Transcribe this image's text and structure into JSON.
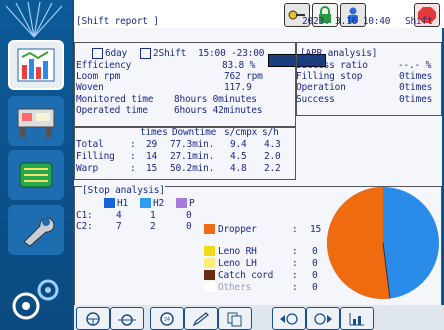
{
  "header": {
    "title": "Shift report",
    "datetime": "2023. 3.16 10:40",
    "mode": "Shift"
  },
  "period": {
    "day_label": "6day",
    "shift_label": "2Shift",
    "shift_time": "15:00 -23:00"
  },
  "stats": [
    {
      "label": "Efficiency",
      "value": "83.8 %"
    },
    {
      "label": "Loom rpm",
      "value": "762 rpm"
    },
    {
      "label": "Woven",
      "value": "117.9"
    },
    {
      "label": "Monitored time",
      "value": "8hours 0minutes"
    },
    {
      "label": "Operated time",
      "value": "6hours 42minutes"
    }
  ],
  "stop_table": {
    "headers": [
      "times",
      "Downtime",
      "s/cmpx",
      "s/h"
    ],
    "rows": [
      {
        "name": "Total",
        "times": "29",
        "downtime": "77.3min.",
        "scmpx": "9.4",
        "sh": "4.3"
      },
      {
        "name": "Filling",
        "times": "14",
        "downtime": "27.1min.",
        "scmpx": "4.5",
        "sh": "2.0"
      },
      {
        "name": "Warp",
        "times": "15",
        "downtime": "50.2min.",
        "scmpx": "4.8",
        "sh": "2.2"
      }
    ]
  },
  "apr": {
    "title": "APR analysis",
    "rows": [
      {
        "label": "Success ratio",
        "value": "--.- %"
      },
      {
        "label": "Filling stop",
        "value": "0times"
      },
      {
        "label": "Operation",
        "value": "0times"
      },
      {
        "label": "Success",
        "value": "0times"
      }
    ]
  },
  "stop_analysis": {
    "title": "Stop analysis",
    "columns": [
      {
        "label": "H1",
        "color": "#1565d8"
      },
      {
        "label": "H2",
        "color": "#2e9cf0"
      },
      {
        "label": "P",
        "color": "#a77bdc"
      }
    ],
    "rows": [
      {
        "name": "C1:",
        "values": [
          "4",
          "1",
          "0"
        ]
      },
      {
        "name": "C2:",
        "values": [
          "7",
          "2",
          "0"
        ]
      }
    ],
    "categories": [
      {
        "label": "Dropper",
        "value": "15",
        "color": "#f06a10"
      },
      {
        "label": "Leno RH",
        "value": "0",
        "color": "#f2d81c"
      },
      {
        "label": "Leno LH",
        "value": "0",
        "color": "#ffef7a"
      },
      {
        "label": "Catch cord",
        "value": "0",
        "color": "#6b2a10"
      },
      {
        "label": "Others",
        "value": "0",
        "color": "#ffffff"
      }
    ],
    "pie": {
      "orange_percent": 52,
      "blue_percent": 48
    }
  },
  "colors": {
    "orange": "#f06a10",
    "blue": "#2a8be8"
  }
}
